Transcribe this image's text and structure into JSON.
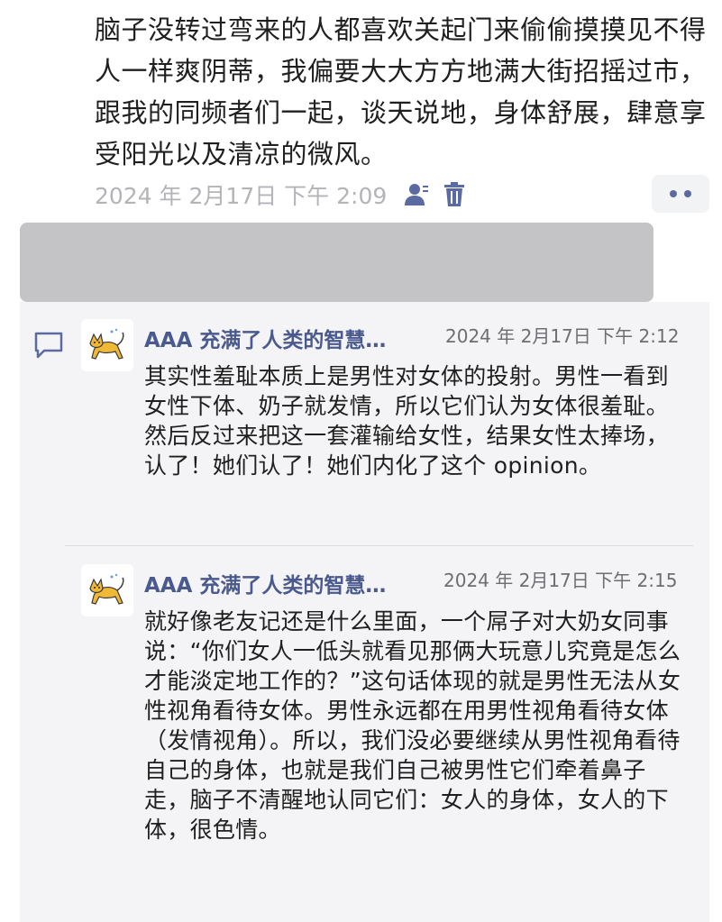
{
  "post": {
    "text": "脑子没转过弯来的人都喜欢关起门来偷偷摸摸见不得人一样爽阴蒂，我偏要大大方方地满大街招摇过市，跟我的同频者们一起，谈天说地，身体舒展，肆意享受阳光以及清凉的微风。",
    "timestamp": "2024 年 2月17日 下午 2:09",
    "icons": [
      "person-icon",
      "trash-icon",
      "more-icon"
    ]
  },
  "comments": [
    {
      "author": "AAA 充满了人类的智慧…",
      "time": "2024 年 2月17日 下午 2:12",
      "body": "其实性羞耻本质上是男性对女体的投射。男性一看到女性下体、奶子就发情，所以它们认为女体很羞耻。然后反过来把这一套灌输给女性，结果女性太捧场，认了！她们认了！她们内化了这个 opinion。"
    },
    {
      "author": "AAA 充满了人类的智慧…",
      "time": "2024 年 2月17日 下午 2:15",
      "body": "就好像老友记还是什么里面，一个屌子对大奶女同事说：“你们女人一低头就看见那俩大玩意儿究竟是怎么才能淡定地工作的？”这句话体现的就是男性无法从女性视角看待女体。男性永远都在用男性视角看待女体（发情视角）。所以，我们没必要继续从男性视角看待自己的身体，也就是我们自己被男性它们牵着鼻子走，脑子不清醒地认同它们：女人的身体，女人的下体，很色情。"
    }
  ],
  "colors": {
    "accent": "#4b5a8e",
    "panel": "#f4f4f6",
    "blur": "#c4c4c6"
  }
}
